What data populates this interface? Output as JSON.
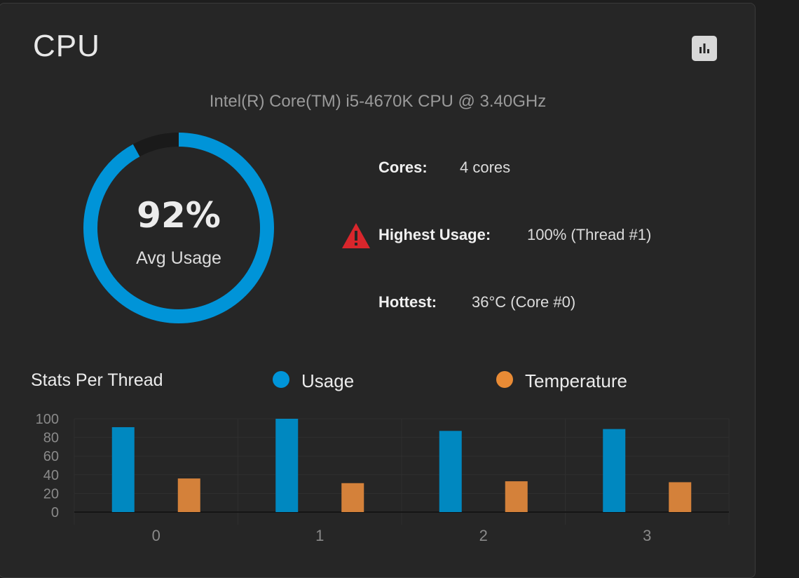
{
  "card": {
    "title": "CPU",
    "chart_button_icon": "bar-chart-icon",
    "cpu_model": "Intel(R) Core(TM) i5-4670K CPU @ 3.40GHz"
  },
  "gauge": {
    "value_text": "92%",
    "value": 92,
    "label": "Avg Usage",
    "color": "#0094d8",
    "track_color": "#1a1a1a"
  },
  "stats": {
    "cores_label": "Cores:",
    "cores_value": "4 cores",
    "highest_label": "Highest Usage:",
    "highest_value": "100%  (Thread #1)",
    "highest_icon": "warning-icon",
    "warning_color": "#d9262c",
    "hottest_label": "Hottest:",
    "hottest_value": "36°C  (Core #0)"
  },
  "thread_stats": {
    "title": "Stats Per Thread",
    "legend": [
      {
        "label": "Usage",
        "color": "#0094d8"
      },
      {
        "label": "Temperature",
        "color": "#e98b35"
      }
    ]
  },
  "chart_data": {
    "type": "bar",
    "categories": [
      "0",
      "1",
      "2",
      "3"
    ],
    "series": [
      {
        "name": "Usage",
        "values": [
          91,
          100,
          87,
          89
        ],
        "color": "#0088c0"
      },
      {
        "name": "Temperature",
        "values": [
          36,
          31,
          33,
          32
        ],
        "color": "#d4813a"
      }
    ],
    "ylim": [
      0,
      100
    ],
    "yticks": [
      "100",
      "80",
      "60",
      "40",
      "20",
      "0"
    ],
    "ytick_values": [
      100,
      80,
      60,
      40,
      20,
      0
    ],
    "grid": true
  }
}
